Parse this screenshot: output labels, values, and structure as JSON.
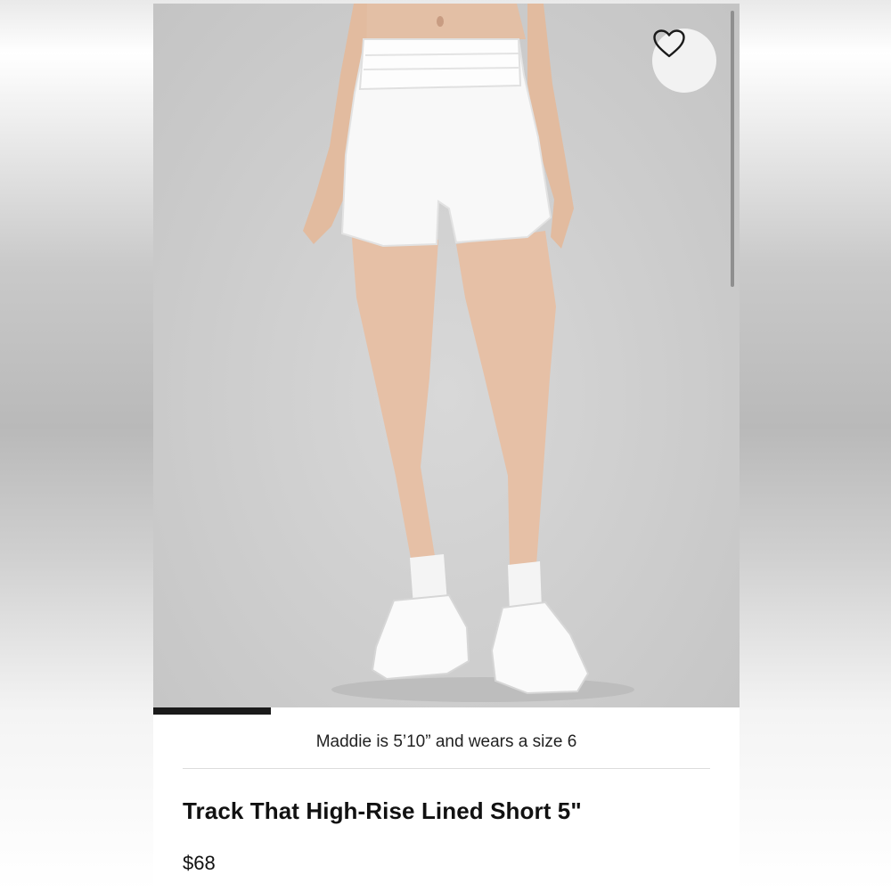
{
  "product": {
    "title": "Track That High-Rise Lined Short 5\"",
    "price": "$68",
    "model_info": "Maddie is 5’10” and wears a size 6",
    "image_description": "model-wearing-white-shorts"
  },
  "gallery": {
    "progress": 0.2
  },
  "icons": {
    "favorite": "heart-outline-icon"
  },
  "colors": {
    "progress_bar": "#1a1a1a",
    "text": "#111111"
  }
}
